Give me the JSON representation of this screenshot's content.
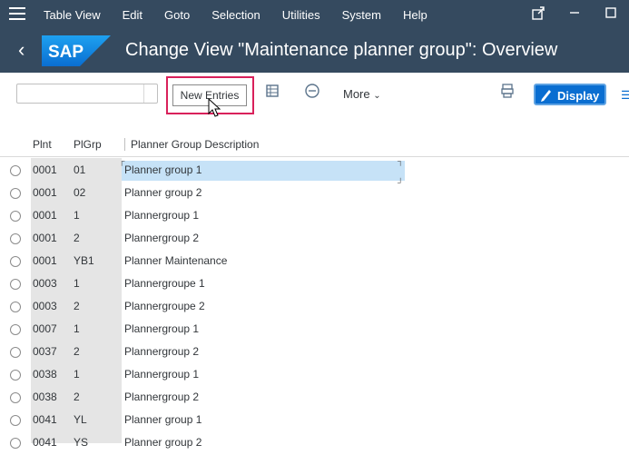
{
  "menubar": {
    "items": [
      "Table View",
      "Edit",
      "Goto",
      "Selection",
      "Utilities",
      "System",
      "Help"
    ]
  },
  "titlebar": {
    "logo": "SAP",
    "title": "Change View \"Maintenance planner group\": Overview"
  },
  "toolbar": {
    "new_entries": "New Entries",
    "more": "More",
    "display": "Display"
  },
  "table": {
    "headers": [
      "Plnt",
      "PlGrp",
      "Planner Group Description"
    ],
    "rows": [
      {
        "plnt": "0001",
        "plgrp": "01",
        "desc": "Planner group 1"
      },
      {
        "plnt": "0001",
        "plgrp": "02",
        "desc": "Planner group 2"
      },
      {
        "plnt": "0001",
        "plgrp": "1",
        "desc": "Plannergroup 1"
      },
      {
        "plnt": "0001",
        "plgrp": "2",
        "desc": "Plannergroup 2"
      },
      {
        "plnt": "0001",
        "plgrp": "YB1",
        "desc": "Planner Maintenance"
      },
      {
        "plnt": "0003",
        "plgrp": "1",
        "desc": "Plannergroupe 1"
      },
      {
        "plnt": "0003",
        "plgrp": "2",
        "desc": "Plannergroupe 2"
      },
      {
        "plnt": "0007",
        "plgrp": "1",
        "desc": "Plannergroup 1"
      },
      {
        "plnt": "0037",
        "plgrp": "2",
        "desc": "Plannergroup 2"
      },
      {
        "plnt": "0038",
        "plgrp": "1",
        "desc": "Plannergroup 1"
      },
      {
        "plnt": "0038",
        "plgrp": "2",
        "desc": "Plannergroup 2"
      },
      {
        "plnt": "0041",
        "plgrp": "YL",
        "desc": "Planner group 1"
      },
      {
        "plnt": "0041",
        "plgrp": "YS",
        "desc": "Planner group 2"
      }
    ]
  },
  "colors": {
    "shell": "#354a5f",
    "accent": "#0a6ed1",
    "highlight_frame": "#d9215b",
    "selected_row": "#c6e2f7"
  }
}
